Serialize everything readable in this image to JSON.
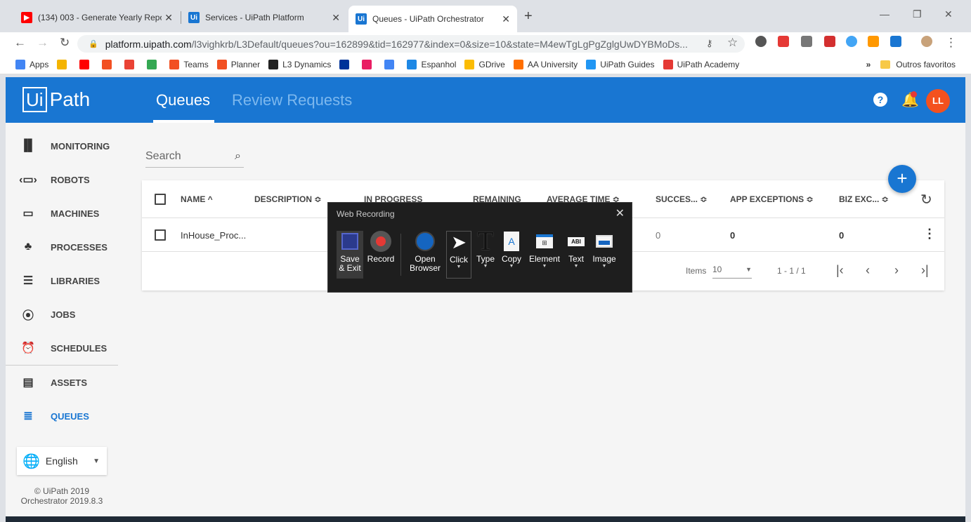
{
  "browser": {
    "tabs": [
      {
        "title": "(134) 003 - Generate Yearly Repo"
      },
      {
        "title": "Services - UiPath Platform"
      },
      {
        "title": "Queues - UiPath Orchestrator"
      }
    ],
    "url_host": "platform.uipath.com",
    "url_rest": "/l3vighkrb/L3Default/queues?ou=162899&tid=162977&index=0&size=10&state=M4ewTgLgPgZglgUwDYBMoDs...",
    "bookmarks": [
      {
        "label": "Apps",
        "color": "#4285f4"
      },
      {
        "label": "",
        "color": "#f4b400"
      },
      {
        "label": "",
        "color": "#ff0000"
      },
      {
        "label": "",
        "color": "#f25022"
      },
      {
        "label": "",
        "color": "#ea4335"
      },
      {
        "label": "",
        "color": "#34a853"
      },
      {
        "label": "Teams",
        "color": "#f25022"
      },
      {
        "label": "Planner",
        "color": "#f25022"
      },
      {
        "label": "L3 Dynamics",
        "color": "#222222"
      },
      {
        "label": "",
        "color": "#003399"
      },
      {
        "label": "",
        "color": "#e91e63"
      },
      {
        "label": "",
        "color": "#4285f4"
      },
      {
        "label": "Espanhol",
        "color": "#1e88e5"
      },
      {
        "label": "GDrive",
        "color": "#fbbc04"
      },
      {
        "label": "AA University",
        "color": "#ff6f00"
      },
      {
        "label": "UiPath Guides",
        "color": "#2196f3"
      },
      {
        "label": "UiPath Academy",
        "color": "#e53935"
      }
    ],
    "other_bookmarks": "Outros favoritos",
    "overflow": "»"
  },
  "header": {
    "logo_ui": "Ui",
    "logo_path": "Path",
    "tabs": [
      "Queues",
      "Review Requests"
    ],
    "help": "?",
    "avatar": "LL"
  },
  "sidebar": {
    "items": [
      {
        "label": "MONITORING",
        "icon": "▐▌"
      },
      {
        "label": "ROBOTS",
        "icon": "‹▭›"
      },
      {
        "label": "MACHINES",
        "icon": "▭"
      },
      {
        "label": "PROCESSES",
        "icon": "♣"
      },
      {
        "label": "LIBRARIES",
        "icon": "☰"
      },
      {
        "label": "JOBS",
        "icon": "⦿"
      },
      {
        "label": "SCHEDULES",
        "icon": "⏰"
      },
      {
        "label": "ASSETS",
        "icon": "▤"
      },
      {
        "label": "QUEUES",
        "icon": "≣"
      }
    ],
    "language": "English",
    "copyright": "© UiPath 2019",
    "version": "Orchestrator 2019.8.3"
  },
  "search": {
    "placeholder": "Search"
  },
  "table": {
    "columns": [
      "NAME ^",
      "DESCRIPTION ≎",
      "IN PROGRESS",
      "REMAINING",
      "AVERAGE TIME ≎",
      "SUCCES... ≎",
      "APP EXCEPTIONS ≎",
      "BIZ EXC... ≎"
    ],
    "rows": [
      {
        "name": "InHouse_Proc...",
        "successful": "0",
        "app_exceptions": "0",
        "biz_exceptions": "0"
      }
    ]
  },
  "pager": {
    "items_label": "Items",
    "page_size": "10",
    "range": "1 - 1 / 1"
  },
  "web_recording": {
    "title": "Web Recording",
    "buttons": [
      {
        "label": "Save\n& Exit"
      },
      {
        "label": "Record"
      },
      {
        "label": "Open\nBrowser"
      },
      {
        "label": "Click"
      },
      {
        "label": "Type"
      },
      {
        "label": "Copy"
      },
      {
        "label": "Element"
      },
      {
        "label": "Text"
      },
      {
        "label": "Image"
      }
    ]
  }
}
